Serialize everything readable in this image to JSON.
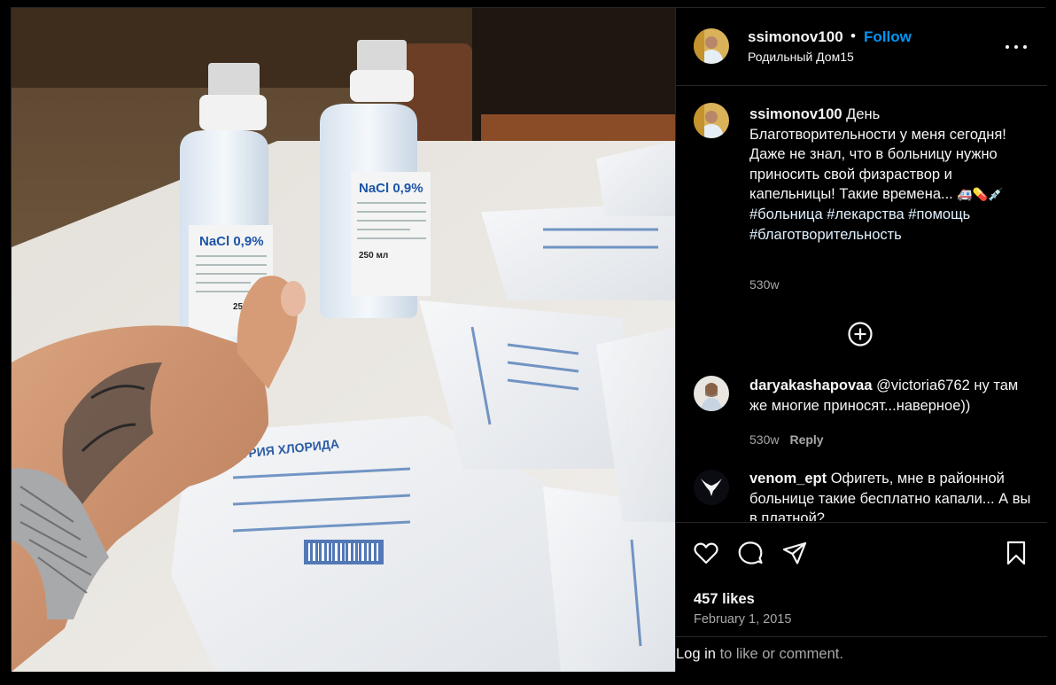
{
  "post": {
    "username": "ssimonov100",
    "follow_label": "Follow",
    "separator": "•",
    "location": "Родильный Дом15",
    "more_icon": "more-horizontal-icon"
  },
  "caption": {
    "username": "ssimonov100",
    "text": "День Благотворительности у меня сегодня! Даже не знал, что в больницу нужно приносить свой физраствор и капельницы! Такие времена...",
    "emojis": "🚑💊💉",
    "hashtags": [
      "#больница",
      "#лекарства",
      "#помощь",
      "#благотворительность"
    ],
    "time": "530w"
  },
  "load_more_icon": "plus-circle-icon",
  "comments": [
    {
      "username": "daryakashapovaa",
      "text": "@victoria6762 ну там же многие приносят...наверное))",
      "time": "530w",
      "reply_label": "Reply"
    },
    {
      "username": "venom_ept",
      "text": "Офигеть, мне в районной больнице такие бесплатно капали... А вы в платной?"
    }
  ],
  "actions": {
    "icons": [
      "heart-icon",
      "comment-icon",
      "share-icon",
      "bookmark-icon"
    ],
    "likes": "457 likes",
    "date": "February 1, 2015"
  },
  "login": {
    "link_label": "Log in",
    "rest": "to like or comment."
  },
  "photo": {
    "bottle_label": "NaCl 0,9%",
    "bottle_volume": "250 мл",
    "bag_label": "НАТРИЯ ХЛОРИДА"
  },
  "colors": {
    "accent": "#0095f6",
    "background": "#000000",
    "secondary_text": "#a8a8a8",
    "divider": "#262626"
  }
}
